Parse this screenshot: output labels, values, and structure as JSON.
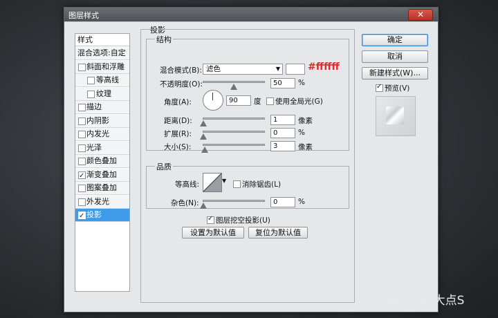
{
  "window": {
    "title": "图层样式",
    "close_glyph": "✕"
  },
  "style_list": {
    "header": "样式",
    "items": [
      {
        "label": "混合选项:自定",
        "checkbox": false,
        "checked": false,
        "indent": false,
        "selected": false
      },
      {
        "label": "斜面和浮雕",
        "checkbox": true,
        "checked": false,
        "indent": false,
        "selected": false
      },
      {
        "label": "等高线",
        "checkbox": true,
        "checked": false,
        "indent": true,
        "selected": false
      },
      {
        "label": "纹理",
        "checkbox": true,
        "checked": false,
        "indent": true,
        "selected": false
      },
      {
        "label": "描边",
        "checkbox": true,
        "checked": false,
        "indent": false,
        "selected": false
      },
      {
        "label": "内阴影",
        "checkbox": true,
        "checked": false,
        "indent": false,
        "selected": false
      },
      {
        "label": "内发光",
        "checkbox": true,
        "checked": false,
        "indent": false,
        "selected": false
      },
      {
        "label": "光泽",
        "checkbox": true,
        "checked": false,
        "indent": false,
        "selected": false
      },
      {
        "label": "颜色叠加",
        "checkbox": true,
        "checked": false,
        "indent": false,
        "selected": false
      },
      {
        "label": "渐变叠加",
        "checkbox": true,
        "checked": true,
        "indent": false,
        "selected": false
      },
      {
        "label": "图案叠加",
        "checkbox": true,
        "checked": false,
        "indent": false,
        "selected": false
      },
      {
        "label": "外发光",
        "checkbox": true,
        "checked": false,
        "indent": false,
        "selected": false
      },
      {
        "label": "投影",
        "checkbox": true,
        "checked": true,
        "indent": false,
        "selected": true
      }
    ]
  },
  "drop_shadow": {
    "section_title": "投影",
    "structure": {
      "title": "结构",
      "blend_mode_label": "混合模式(B):",
      "blend_mode_value": "滤色",
      "color_value": "#ffffff",
      "color_annotation": "#ffffff",
      "opacity_label": "不透明度(O):",
      "opacity_value": "50",
      "opacity_unit": "%",
      "opacity_fraction": 0.5,
      "angle_label": "角度(A):",
      "angle_value": "90",
      "angle_unit": "度",
      "global_light_label": "使用全局光(G)",
      "global_light_checked": false,
      "distance_label": "距离(D):",
      "distance_value": "1",
      "distance_unit": "像素",
      "spread_label": "扩展(R):",
      "spread_value": "0",
      "spread_unit": "%",
      "size_label": "大小(S):",
      "size_value": "3",
      "size_unit": "像素"
    },
    "quality": {
      "title": "品质",
      "contour_label": "等高线:",
      "anti_alias_label": "消除锯齿(L)",
      "anti_alias_checked": false,
      "noise_label": "杂色(N):",
      "noise_value": "0",
      "noise_unit": "%"
    },
    "knockout_label": "图层挖空投影(U)",
    "knockout_checked": true,
    "make_default_label": "设置为默认值",
    "reset_default_label": "复位为默认值"
  },
  "buttons": {
    "ok": "确定",
    "cancel": "取消",
    "new_style": "新建样式(W)...",
    "preview_label": "预览(V)",
    "preview_checked": true
  },
  "watermark": "知乎 @P大点S",
  "colors": {
    "selection": "#3f9ae8",
    "annotation": "#e5262c",
    "close": "#c7412f"
  }
}
